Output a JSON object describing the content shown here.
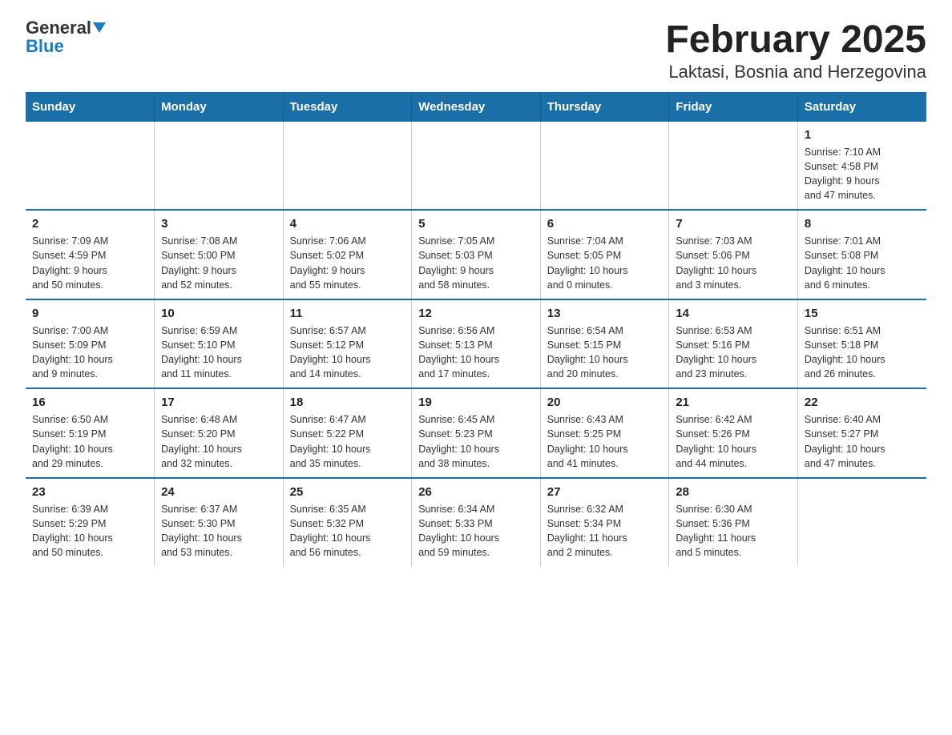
{
  "logo": {
    "general": "General",
    "blue": "Blue"
  },
  "title": "February 2025",
  "subtitle": "Laktasi, Bosnia and Herzegovina",
  "days_of_week": [
    "Sunday",
    "Monday",
    "Tuesday",
    "Wednesday",
    "Thursday",
    "Friday",
    "Saturday"
  ],
  "weeks": [
    [
      {
        "day": "",
        "info": ""
      },
      {
        "day": "",
        "info": ""
      },
      {
        "day": "",
        "info": ""
      },
      {
        "day": "",
        "info": ""
      },
      {
        "day": "",
        "info": ""
      },
      {
        "day": "",
        "info": ""
      },
      {
        "day": "1",
        "info": "Sunrise: 7:10 AM\nSunset: 4:58 PM\nDaylight: 9 hours\nand 47 minutes."
      }
    ],
    [
      {
        "day": "2",
        "info": "Sunrise: 7:09 AM\nSunset: 4:59 PM\nDaylight: 9 hours\nand 50 minutes."
      },
      {
        "day": "3",
        "info": "Sunrise: 7:08 AM\nSunset: 5:00 PM\nDaylight: 9 hours\nand 52 minutes."
      },
      {
        "day": "4",
        "info": "Sunrise: 7:06 AM\nSunset: 5:02 PM\nDaylight: 9 hours\nand 55 minutes."
      },
      {
        "day": "5",
        "info": "Sunrise: 7:05 AM\nSunset: 5:03 PM\nDaylight: 9 hours\nand 58 minutes."
      },
      {
        "day": "6",
        "info": "Sunrise: 7:04 AM\nSunset: 5:05 PM\nDaylight: 10 hours\nand 0 minutes."
      },
      {
        "day": "7",
        "info": "Sunrise: 7:03 AM\nSunset: 5:06 PM\nDaylight: 10 hours\nand 3 minutes."
      },
      {
        "day": "8",
        "info": "Sunrise: 7:01 AM\nSunset: 5:08 PM\nDaylight: 10 hours\nand 6 minutes."
      }
    ],
    [
      {
        "day": "9",
        "info": "Sunrise: 7:00 AM\nSunset: 5:09 PM\nDaylight: 10 hours\nand 9 minutes."
      },
      {
        "day": "10",
        "info": "Sunrise: 6:59 AM\nSunset: 5:10 PM\nDaylight: 10 hours\nand 11 minutes."
      },
      {
        "day": "11",
        "info": "Sunrise: 6:57 AM\nSunset: 5:12 PM\nDaylight: 10 hours\nand 14 minutes."
      },
      {
        "day": "12",
        "info": "Sunrise: 6:56 AM\nSunset: 5:13 PM\nDaylight: 10 hours\nand 17 minutes."
      },
      {
        "day": "13",
        "info": "Sunrise: 6:54 AM\nSunset: 5:15 PM\nDaylight: 10 hours\nand 20 minutes."
      },
      {
        "day": "14",
        "info": "Sunrise: 6:53 AM\nSunset: 5:16 PM\nDaylight: 10 hours\nand 23 minutes."
      },
      {
        "day": "15",
        "info": "Sunrise: 6:51 AM\nSunset: 5:18 PM\nDaylight: 10 hours\nand 26 minutes."
      }
    ],
    [
      {
        "day": "16",
        "info": "Sunrise: 6:50 AM\nSunset: 5:19 PM\nDaylight: 10 hours\nand 29 minutes."
      },
      {
        "day": "17",
        "info": "Sunrise: 6:48 AM\nSunset: 5:20 PM\nDaylight: 10 hours\nand 32 minutes."
      },
      {
        "day": "18",
        "info": "Sunrise: 6:47 AM\nSunset: 5:22 PM\nDaylight: 10 hours\nand 35 minutes."
      },
      {
        "day": "19",
        "info": "Sunrise: 6:45 AM\nSunset: 5:23 PM\nDaylight: 10 hours\nand 38 minutes."
      },
      {
        "day": "20",
        "info": "Sunrise: 6:43 AM\nSunset: 5:25 PM\nDaylight: 10 hours\nand 41 minutes."
      },
      {
        "day": "21",
        "info": "Sunrise: 6:42 AM\nSunset: 5:26 PM\nDaylight: 10 hours\nand 44 minutes."
      },
      {
        "day": "22",
        "info": "Sunrise: 6:40 AM\nSunset: 5:27 PM\nDaylight: 10 hours\nand 47 minutes."
      }
    ],
    [
      {
        "day": "23",
        "info": "Sunrise: 6:39 AM\nSunset: 5:29 PM\nDaylight: 10 hours\nand 50 minutes."
      },
      {
        "day": "24",
        "info": "Sunrise: 6:37 AM\nSunset: 5:30 PM\nDaylight: 10 hours\nand 53 minutes."
      },
      {
        "day": "25",
        "info": "Sunrise: 6:35 AM\nSunset: 5:32 PM\nDaylight: 10 hours\nand 56 minutes."
      },
      {
        "day": "26",
        "info": "Sunrise: 6:34 AM\nSunset: 5:33 PM\nDaylight: 10 hours\nand 59 minutes."
      },
      {
        "day": "27",
        "info": "Sunrise: 6:32 AM\nSunset: 5:34 PM\nDaylight: 11 hours\nand 2 minutes."
      },
      {
        "day": "28",
        "info": "Sunrise: 6:30 AM\nSunset: 5:36 PM\nDaylight: 11 hours\nand 5 minutes."
      },
      {
        "day": "",
        "info": ""
      }
    ]
  ]
}
